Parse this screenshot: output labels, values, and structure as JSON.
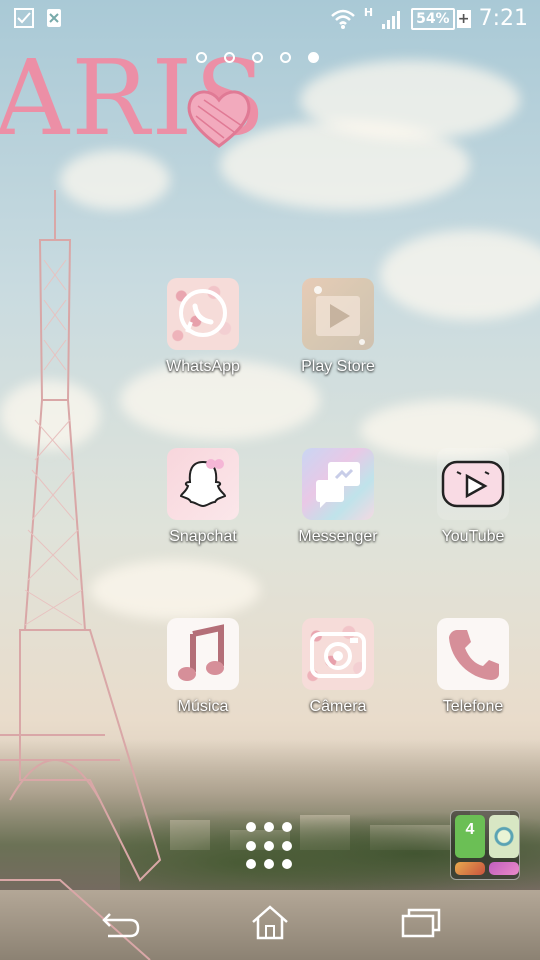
{
  "status_bar": {
    "battery_percent": "54%",
    "network_type": "H",
    "time": "7:21",
    "left_icons": [
      "checkbox-notification-icon",
      "file-notification-icon"
    ],
    "right_icons": [
      "wifi-icon",
      "signal-icon",
      "battery-icon"
    ]
  },
  "home_pages": {
    "count": 5,
    "active_index": 4
  },
  "wallpaper": {
    "banner_text": "ARIS"
  },
  "apps": [
    {
      "label": "WhatsApp",
      "icon": "whatsapp-icon"
    },
    {
      "label": "Play Store",
      "icon": "play-store-icon"
    },
    {
      "label": "Snapchat",
      "icon": "snapchat-icon"
    },
    {
      "label": "Messenger",
      "icon": "messenger-icon"
    },
    {
      "label": "YouTube",
      "icon": "youtube-icon"
    },
    {
      "label": "Música",
      "icon": "music-icon"
    },
    {
      "label": "Câmera",
      "icon": "camera-icon"
    },
    {
      "label": "Telefone",
      "icon": "phone-icon"
    }
  ],
  "dock": {
    "app_drawer_icon": "app-drawer-icon",
    "folder_icons": [
      "four-icon",
      "green-game-icon",
      "game-icon",
      "barbie-game-icon"
    ]
  },
  "nav_bar": [
    "back-icon",
    "home-icon",
    "recent-apps-icon"
  ],
  "colors": {
    "accent_pink": "#ec8fa6",
    "icon_pink": "#e9a3aa"
  }
}
